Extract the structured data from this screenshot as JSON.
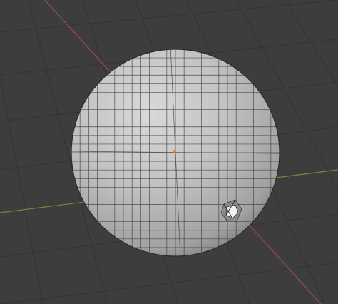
{
  "viewport": {
    "kind": "3d-viewport",
    "background_color": "#3d3d3d",
    "grid_color": "#333333",
    "x_axis_color": "#9b4a52",
    "y_axis_color": "#6f8d3a"
  },
  "object": {
    "kind": "quad-sphere-mesh",
    "base_color": "#b9b9b9",
    "edge_color": "#3a3a3a",
    "origin_color": "#e8822a",
    "artifact": "pinched-face"
  }
}
